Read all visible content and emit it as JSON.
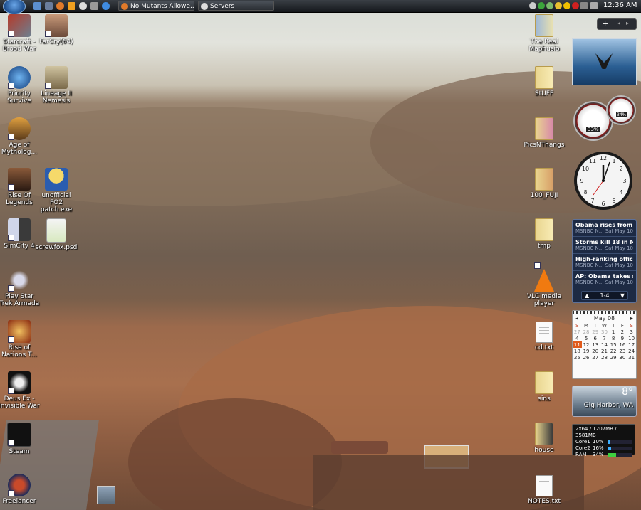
{
  "taskbar": {
    "windows": [
      {
        "title": "No Mutants Allowe...",
        "icon": "firefox-icon"
      },
      {
        "title": "Servers",
        "icon": "steam-icon"
      }
    ],
    "clock": "12:36 AM"
  },
  "desktop_icons_left": [
    {
      "label": "Starcraft - Brood War",
      "icon": "starcraft-icon",
      "shortcut": true
    },
    {
      "label": "FarCry(64)",
      "icon": "farcry-icon",
      "shortcut": true
    },
    {
      "label": "Priority Survive",
      "icon": "priority-icon",
      "shortcut": true
    },
    {
      "label": "Lineage II Nemesis",
      "icon": "lineage-icon",
      "shortcut": true
    },
    {
      "label": "Age of Mytholog...",
      "icon": "age-of-mythology-icon",
      "shortcut": true
    },
    {
      "label": "Rise Of Legends",
      "icon": "rise-of-legends-icon",
      "shortcut": true
    },
    {
      "label": "unofficial FO2 patch.exe",
      "icon": "fallout-vault-boy-icon",
      "shortcut": false
    },
    {
      "label": "SimCity 4",
      "icon": "simcity-icon",
      "shortcut": true
    },
    {
      "label": "screwfox.psd",
      "icon": "psd-file-icon",
      "shortcut": false
    },
    {
      "label": "Play Star Trek Armada",
      "icon": "star-trek-ship-icon",
      "shortcut": true
    },
    {
      "label": "Rise of Nations T...",
      "icon": "rise-of-nations-icon",
      "shortcut": true
    },
    {
      "label": "Deus Ex - Invisible War",
      "icon": "deus-ex-icon",
      "shortcut": true
    },
    {
      "label": "Steam",
      "icon": "steam-icon",
      "shortcut": true
    },
    {
      "label": "Freelancer",
      "icon": "freelancer-icon",
      "shortcut": true
    }
  ],
  "desktop_icons_right": [
    {
      "label": "The Real Maphusio",
      "icon": "folder-icon"
    },
    {
      "label": "StUFF",
      "icon": "folder-icon"
    },
    {
      "label": "PicsNThangs",
      "icon": "folder-icon"
    },
    {
      "label": "100_FUJI",
      "icon": "folder-icon"
    },
    {
      "label": "tmp",
      "icon": "folder-icon"
    },
    {
      "label": "VLC media player",
      "icon": "vlc-cone-icon"
    },
    {
      "label": "cd.txt",
      "icon": "text-file-icon"
    },
    {
      "label": "sins",
      "icon": "folder-icon"
    },
    {
      "label": "house",
      "icon": "folder-icon"
    },
    {
      "label": "NOTES.txt",
      "icon": "text-file-icon"
    }
  ],
  "gadgets": {
    "meter_cpu": "33%",
    "meter_mem": "34%",
    "news": [
      {
        "headline": "Obama rises from ob...",
        "source": "MSNBC N...",
        "date": "Sat May 10"
      },
      {
        "headline": "Storms kill 18 in Mis...",
        "source": "MSNBC N...",
        "date": "Sat May 10"
      },
      {
        "headline": "High-ranking officer ...",
        "source": "MSNBC N...",
        "date": "Sat May 10"
      },
      {
        "headline": "AP: Obama takes su...",
        "source": "MSNBC N...",
        "date": "Sat May 10"
      }
    ],
    "news_pager": "1-4",
    "calendar": {
      "month": "May 08",
      "days_header": [
        "S",
        "M",
        "T",
        "W",
        "T",
        "F",
        "S"
      ],
      "weeks": [
        [
          "27",
          "28",
          "29",
          "30",
          "1",
          "2",
          "3"
        ],
        [
          "4",
          "5",
          "6",
          "7",
          "8",
          "9",
          "10"
        ],
        [
          "11",
          "12",
          "13",
          "14",
          "15",
          "16",
          "17"
        ],
        [
          "18",
          "19",
          "20",
          "21",
          "22",
          "23",
          "24"
        ],
        [
          "25",
          "26",
          "27",
          "28",
          "29",
          "30",
          "31"
        ]
      ],
      "today": "11"
    },
    "weather": {
      "temp": "8°",
      "location": "Gig Harbor, WA"
    },
    "sysmon": {
      "header": "2x64 / 1207MB / 3581MB",
      "rows": [
        {
          "name": "Core1",
          "value": "10%",
          "level": 0.1
        },
        {
          "name": "Core2",
          "value": "16%",
          "level": 0.16
        },
        {
          "name": "RAM",
          "value": "34%",
          "level": 0.34
        }
      ]
    }
  },
  "colors": {
    "taskbar": "#1c2025",
    "gadget_blue": "#1d2a44",
    "calendar_today": "#e05a1b"
  }
}
